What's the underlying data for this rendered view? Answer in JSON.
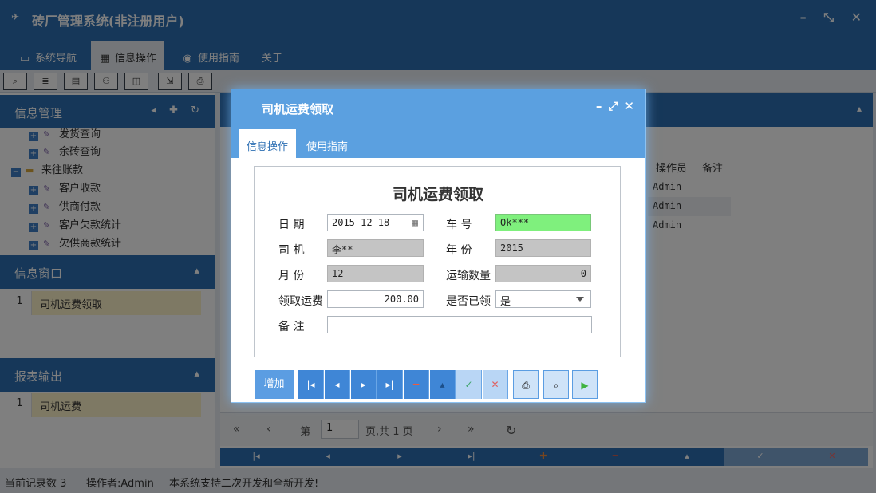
{
  "app": {
    "title": "砖厂管理系统(非注册用户)",
    "menu_tabs": [
      {
        "label": "系统导航",
        "icon": "monitor-icon"
      },
      {
        "label": "信息操作",
        "icon": "grid-icon"
      },
      {
        "label": "使用指南",
        "icon": "help-icon"
      },
      {
        "label": "关于",
        "icon": ""
      }
    ],
    "toolbar_icons": [
      "search-icon",
      "list-icon",
      "document-icon",
      "users-icon",
      "window-icon",
      "export-icon",
      "print-icon"
    ]
  },
  "left_panel": {
    "info_mgmt": {
      "title": "信息管理",
      "tree": [
        {
          "label": "发货查询",
          "type": "leaf"
        },
        {
          "label": "余砖查询",
          "type": "leaf"
        },
        {
          "label": "来往账款",
          "type": "folder"
        },
        {
          "label": "客户收款",
          "type": "leaf"
        },
        {
          "label": "供商付款",
          "type": "leaf"
        },
        {
          "label": "客户欠款统计",
          "type": "leaf"
        },
        {
          "label": "欠供商款统计",
          "type": "leaf"
        }
      ]
    },
    "info_window": {
      "title": "信息窗口",
      "rows": [
        {
          "num": "1",
          "label": "司机运费领取"
        }
      ]
    },
    "report_output": {
      "title": "报表输出",
      "rows": [
        {
          "num": "1",
          "label": "司机运费"
        }
      ]
    }
  },
  "grid": {
    "columns": [
      "操作员",
      "备注"
    ],
    "operators": [
      "Admin",
      "Admin",
      "Admin"
    ]
  },
  "pager": {
    "page_prefix": "第",
    "page_value": "1",
    "page_suffix": "页,共 1 页"
  },
  "status_bar": {
    "records": "当前记录数 3",
    "operator": "操作者:Admin",
    "note": "本系统支持二次开发和全新开发!"
  },
  "dialog": {
    "title": "司机运费领取",
    "tabs": [
      "信息操作",
      "使用指南"
    ],
    "form_title": "司机运费领取",
    "fields": {
      "date": {
        "label": "日 期",
        "value": "2015-12-18"
      },
      "car_no": {
        "label": "车 号",
        "value": "Ok***"
      },
      "driver": {
        "label": "司 机",
        "value": "李**"
      },
      "year": {
        "label": "年 份",
        "value": "2015"
      },
      "month": {
        "label": "月 份",
        "value": "12"
      },
      "quantity": {
        "label": "运输数量",
        "value": "0"
      },
      "fee": {
        "label": "领取运费",
        "value": "200.00"
      },
      "received": {
        "label": "是否已领",
        "value": "是"
      },
      "remark": {
        "label": "备 注",
        "value": ""
      }
    },
    "footer": {
      "add_label": "增加"
    }
  },
  "colors": {
    "primary": "#2d6fb3",
    "dialog_bg": "#5ba0e0",
    "readonly": "#c4c4c4",
    "highlight_green": "#7ff07d",
    "row_highlight": "#fdf2c8"
  }
}
